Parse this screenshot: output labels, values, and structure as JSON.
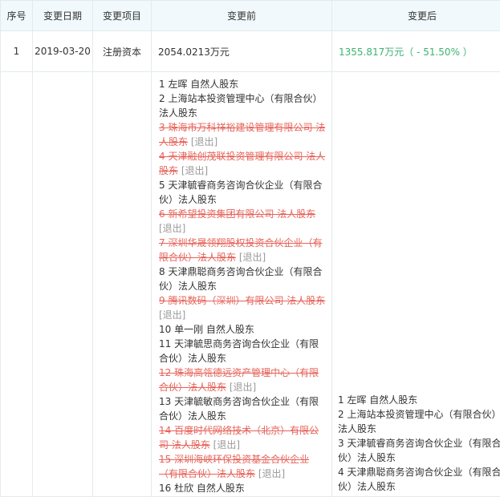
{
  "header": {
    "index": "序号",
    "date": "变更日期",
    "item": "变更项目",
    "before": "变更前",
    "after": "变更后"
  },
  "row1": {
    "index": "1",
    "date": "2019-03-20",
    "item": "注册资本",
    "before": "2054.0213万元",
    "after": "1355.817万元（ - 51.50% ）"
  },
  "row2": {
    "before_entries": [
      {
        "text": "1 左晖 自然人股东",
        "removed": false
      },
      {
        "text": "2 上海站本投资管理中心（有限合伙）法人股东",
        "removed": false
      },
      {
        "text": "3 珠海市万科祥裕建设管理有限公司 法人股东",
        "removed": true
      },
      {
        "text": "4 天津融创茂联投资管理有限公司 法人股东",
        "removed": true
      },
      {
        "text": "5 天津毓睿商务咨询合伙企业（有限合伙）法人股东",
        "removed": false
      },
      {
        "text": "6 新希望投资集团有限公司 法人股东",
        "removed": true
      },
      {
        "text": "7 深圳华晟领翔股权投资合伙企业（有限合伙）法人股东",
        "removed": true
      },
      {
        "text": "8 天津鼎聪商务咨询合伙企业（有限合伙）法人股东",
        "removed": false
      },
      {
        "text": "9 腾讯数码（深圳）有限公司 法人股东",
        "removed": true
      },
      {
        "text": "10 单一刚 自然人股东",
        "removed": false
      },
      {
        "text": "11 天津毓思商务咨询合伙企业（有限合伙）法人股东",
        "removed": false
      },
      {
        "text": "12 珠海高瓴德远资产管理中心（有限合伙）法人股东",
        "removed": true
      },
      {
        "text": "13 天津毓敏商务咨询合伙企业（有限合伙）法人股东",
        "removed": false
      },
      {
        "text": "14 百度时代网络技术（北京）有限公司 法人股东",
        "removed": true
      },
      {
        "text": "15 深圳海峡环保投资基金合伙企业（有限合伙）法人股东",
        "removed": true
      },
      {
        "text": "16 杜欣 自然人股东",
        "removed": false
      }
    ],
    "removed_tag": "[退出]",
    "after_entries": [
      "1 左晖 自然人股东",
      "2 上海站本投资管理中心（有限合伙）法人股东",
      "3 天津毓睿商务咨询合伙企业（有限合伙）法人股东",
      "4 天津鼎聪商务咨询合伙企业（有限合伙）法人股东"
    ]
  },
  "colors": {
    "header_bg": "#f2f9fc",
    "border": "#e4eaec",
    "removed": "#e6635a",
    "increase_text": "#3cb371",
    "tag": "#999999"
  }
}
